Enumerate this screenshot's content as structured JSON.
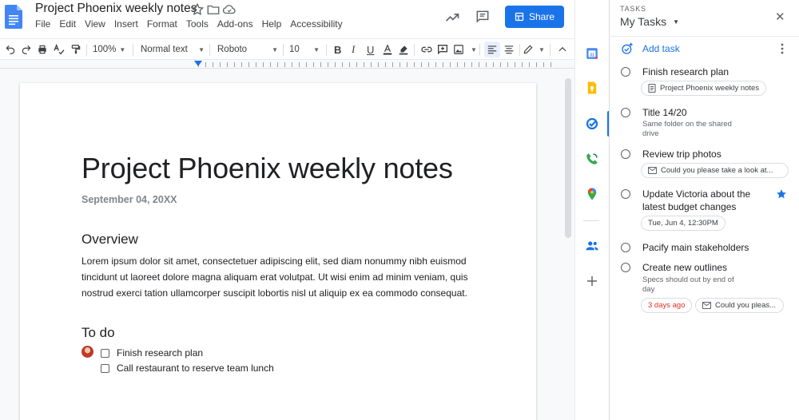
{
  "header": {
    "doc_title": "Project Phoenix weekly notes",
    "menu": [
      "File",
      "Edit",
      "View",
      "Insert",
      "Format",
      "Tools",
      "Add-ons",
      "Help",
      "Accessibility"
    ],
    "share_label": "Share"
  },
  "toolbar": {
    "zoom": "100%",
    "style": "Normal text",
    "font": "Roboto",
    "size": "10"
  },
  "document": {
    "heading": "Project Phoenix weekly notes",
    "date": "September 04, 20XX",
    "overview_heading": "Overview",
    "overview_text": "Lorem ipsum dolor sit amet, consectetuer adipiscing elit, sed diam nonummy nibh euismod tincidunt ut laoreet dolore magna aliquam erat volutpat. Ut wisi enim ad minim veniam, quis nostrud exerci tation ullamcorper suscipit lobortis nisl ut aliquip ex ea commodo consequat.",
    "todo_heading": "To do",
    "todos": [
      "Finish research plan",
      "Call restaurant to reserve team lunch"
    ]
  },
  "tasks_panel": {
    "label": "TASKS",
    "list_name": "My Tasks",
    "add_task": "Add task",
    "tasks": [
      {
        "title": "Finish research plan",
        "chip": "Project Phoenix weekly notes"
      },
      {
        "title": "Title 14/20",
        "subtitle": "Same folder on the shared drive"
      },
      {
        "title": "Review trip photos",
        "chip": "Could you please take a look at..."
      },
      {
        "title": "Update Victoria about the latest budget changes",
        "chip": "Tue, Jun 4, 12:30PM",
        "starred": true
      },
      {
        "title": "Pacify main stakeholders"
      },
      {
        "title": "Create new outlines",
        "subtitle": "Specs should out by end of day",
        "chip_due": "3 days ago",
        "chip": "Could you pleas..."
      }
    ]
  },
  "colors": {
    "accent": "#1a73e8",
    "overdue": "#d93025",
    "star": "#1a73e8"
  }
}
